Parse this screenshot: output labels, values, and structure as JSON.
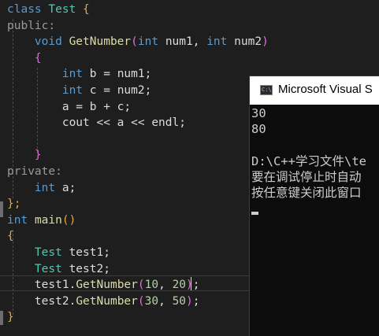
{
  "code_editor": {
    "lines": [
      {
        "parts": [
          {
            "t": "class",
            "c": "kw"
          },
          {
            "t": " ",
            "c": "pl"
          },
          {
            "t": "Test",
            "c": "ty"
          },
          {
            "t": " ",
            "c": "pl"
          },
          {
            "t": "{",
            "c": "br"
          }
        ]
      },
      {
        "parts": [
          {
            "t": "public:",
            "c": "ac"
          }
        ]
      },
      {
        "parts": [
          {
            "t": "    ",
            "c": "pl"
          },
          {
            "t": "void",
            "c": "kw"
          },
          {
            "t": " ",
            "c": "pl"
          },
          {
            "t": "GetNumber",
            "c": "fn"
          },
          {
            "t": "(",
            "c": "br2"
          },
          {
            "t": "int",
            "c": "kw"
          },
          {
            "t": " num1, ",
            "c": "pl"
          },
          {
            "t": "int",
            "c": "kw"
          },
          {
            "t": " num2",
            "c": "pl"
          },
          {
            "t": ")",
            "c": "br2"
          }
        ]
      },
      {
        "parts": [
          {
            "t": "    ",
            "c": "pl"
          },
          {
            "t": "{",
            "c": "br2"
          }
        ]
      },
      {
        "parts": [
          {
            "t": "        ",
            "c": "pl"
          },
          {
            "t": "int",
            "c": "kw"
          },
          {
            "t": " b = num1;",
            "c": "pl"
          }
        ]
      },
      {
        "parts": [
          {
            "t": "        ",
            "c": "pl"
          },
          {
            "t": "int",
            "c": "kw"
          },
          {
            "t": " c = num2;",
            "c": "pl"
          }
        ]
      },
      {
        "parts": [
          {
            "t": "        a = b + c;",
            "c": "pl"
          }
        ]
      },
      {
        "parts": [
          {
            "t": "        cout << a << endl;",
            "c": "pl"
          }
        ]
      },
      {
        "parts": [
          {
            "t": "",
            "c": "pl"
          }
        ]
      },
      {
        "parts": [
          {
            "t": "    ",
            "c": "pl"
          },
          {
            "t": "}",
            "c": "br2"
          }
        ]
      },
      {
        "parts": [
          {
            "t": "private:",
            "c": "ac"
          }
        ]
      },
      {
        "parts": [
          {
            "t": "    ",
            "c": "pl"
          },
          {
            "t": "int",
            "c": "kw"
          },
          {
            "t": " a;",
            "c": "pl"
          }
        ]
      },
      {
        "parts": [
          {
            "t": "};",
            "c": "br"
          }
        ]
      },
      {
        "parts": [
          {
            "t": "int",
            "c": "kw"
          },
          {
            "t": " ",
            "c": "pl"
          },
          {
            "t": "main",
            "c": "fn"
          },
          {
            "t": "()",
            "c": "br"
          }
        ]
      },
      {
        "parts": [
          {
            "t": "{",
            "c": "br"
          }
        ]
      },
      {
        "parts": [
          {
            "t": "    ",
            "c": "pl"
          },
          {
            "t": "Test",
            "c": "ty"
          },
          {
            "t": " test1;",
            "c": "pl"
          }
        ]
      },
      {
        "parts": [
          {
            "t": "    ",
            "c": "pl"
          },
          {
            "t": "Test",
            "c": "ty"
          },
          {
            "t": " test2;",
            "c": "pl"
          }
        ]
      },
      {
        "parts": [
          {
            "t": "    test1.",
            "c": "pl"
          },
          {
            "t": "GetNumber",
            "c": "fn"
          },
          {
            "t": "(",
            "c": "br2"
          },
          {
            "t": "10",
            "c": "nm"
          },
          {
            "t": ", ",
            "c": "pl"
          },
          {
            "t": "20",
            "c": "nm"
          },
          {
            "t": ")",
            "c": "br2"
          },
          {
            "t": ";",
            "c": "pl"
          }
        ]
      },
      {
        "parts": [
          {
            "t": "    test2.",
            "c": "pl"
          },
          {
            "t": "GetNumber",
            "c": "fn"
          },
          {
            "t": "(",
            "c": "br2"
          },
          {
            "t": "30",
            "c": "nm"
          },
          {
            "t": ", ",
            "c": "pl"
          },
          {
            "t": "50",
            "c": "nm"
          },
          {
            "t": ")",
            "c": "br2"
          },
          {
            "t": ";",
            "c": "pl"
          }
        ]
      },
      {
        "parts": [
          {
            "t": "}",
            "c": "br"
          }
        ]
      }
    ]
  },
  "console_window": {
    "title": "Microsoft Visual S",
    "app_icon_text": "C:\\",
    "output": {
      "line1": "30",
      "line2": "80",
      "line3": "",
      "line4": "D:\\C++学习文件\\te",
      "line5": "要在调试停止时自动",
      "line6": "按任意键关闭此窗口"
    }
  },
  "colors": {
    "editor_background": "#1e1e1e",
    "keyword": "#569cd6",
    "type": "#4ec9b0",
    "function": "#dcdcaa",
    "number": "#b5cea8",
    "console_background": "#0c0c0c"
  }
}
